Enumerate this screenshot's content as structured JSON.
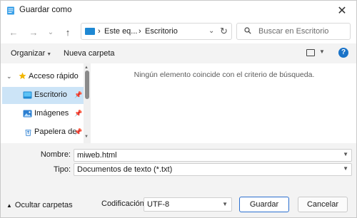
{
  "window": {
    "title": "Guardar como",
    "close_glyph": "✕"
  },
  "nav": {
    "back_glyph": "←",
    "forward_glyph": "→",
    "recent_glyph": "⌄",
    "up_glyph": "↑",
    "breadcrumb": [
      {
        "sep": "›",
        "label": "Este eq..."
      },
      {
        "sep": "›",
        "label": "Escritorio"
      }
    ],
    "address_dropdown_glyph": "⌄",
    "refresh_glyph": "↻",
    "search_placeholder": "Buscar en Escritorio"
  },
  "toolbar": {
    "organize_label": "Organizar",
    "new_folder_label": "Nueva carpeta",
    "help_label": "?"
  },
  "tree": {
    "collapse_glyph": "⌄",
    "quick_access_label": "Acceso rápido",
    "items": [
      {
        "label": "Escritorio",
        "icon": "desktop-folder-icon",
        "selected": true
      },
      {
        "label": "Imágenes",
        "icon": "pictures-folder-icon",
        "selected": false
      },
      {
        "label": "Papelera de",
        "icon": "recycle-bin-icon",
        "selected": false
      }
    ]
  },
  "content": {
    "empty_message": "Ningún elemento coincide con el criterio de búsqueda."
  },
  "form": {
    "name_label": "Nombre:",
    "name_value": "miweb.html",
    "type_label": "Tipo:",
    "type_value": "Documentos de texto (*.txt)"
  },
  "footer": {
    "hide_folders_label": "Ocultar carpetas",
    "encoding_label": "Codificación:",
    "encoding_value": "UTF-8",
    "save_label": "Guardar",
    "cancel_label": "Cancelar"
  },
  "colors": {
    "accent": "#2b6fcf",
    "selection": "#cce4f7",
    "folder_blue": "#1e88d3",
    "star": "#f2b705"
  }
}
